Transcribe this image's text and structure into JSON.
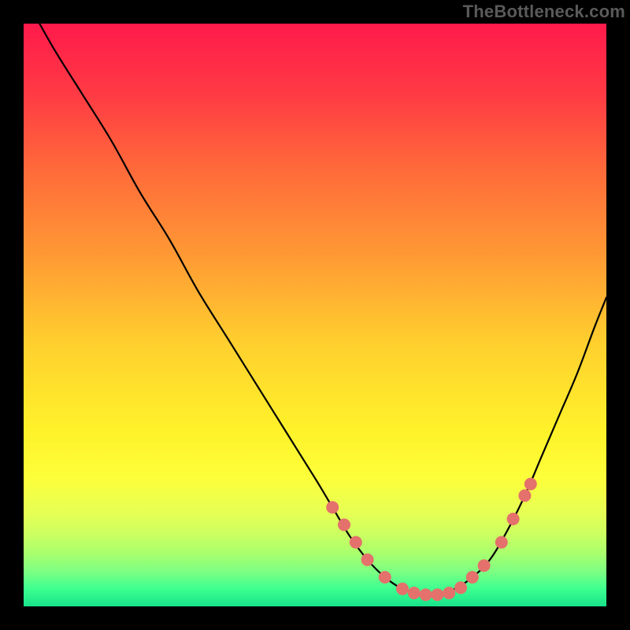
{
  "watermark": {
    "text": "TheBottleneck.com"
  },
  "gradient": {
    "stops": [
      {
        "pct": 0,
        "color": "#ff1a4b"
      },
      {
        "pct": 12,
        "color": "#ff3a44"
      },
      {
        "pct": 25,
        "color": "#ff6a3a"
      },
      {
        "pct": 40,
        "color": "#ff9a34"
      },
      {
        "pct": 55,
        "color": "#ffd02e"
      },
      {
        "pct": 70,
        "color": "#fff22a"
      },
      {
        "pct": 78,
        "color": "#fcff3a"
      },
      {
        "pct": 84,
        "color": "#e6ff55"
      },
      {
        "pct": 88,
        "color": "#c8ff62"
      },
      {
        "pct": 91,
        "color": "#a8ff6e"
      },
      {
        "pct": 94,
        "color": "#7dff82"
      },
      {
        "pct": 97,
        "color": "#3dff90"
      },
      {
        "pct": 100,
        "color": "#18e38a"
      }
    ]
  },
  "curve_color": "#000000",
  "marker_color": "#e4716b",
  "marker_radius": 8,
  "chart_data": {
    "type": "line",
    "title": "",
    "xlabel": "",
    "ylabel": "",
    "xlim": [
      0,
      100
    ],
    "ylim": [
      0,
      100
    ],
    "series": [
      {
        "name": "curve",
        "x": [
          0,
          5,
          10,
          15,
          20,
          25,
          30,
          35,
          40,
          45,
          50,
          53,
          56,
          59,
          62,
          65,
          68,
          71,
          74,
          77,
          80,
          83,
          86,
          89,
          92,
          95,
          98,
          100
        ],
        "values": [
          105,
          96,
          88,
          80,
          71,
          63,
          54,
          46,
          38,
          30,
          22,
          17,
          12,
          8,
          5,
          3,
          2,
          2,
          3,
          5,
          8,
          13,
          19,
          26,
          33,
          40,
          48,
          53
        ]
      }
    ],
    "markers": {
      "name": "highlight-points",
      "x": [
        53,
        55,
        57,
        59,
        62,
        65,
        67,
        69,
        71,
        73,
        75,
        77,
        79,
        82,
        84,
        86,
        87
      ],
      "values": [
        17,
        14,
        11,
        8,
        5,
        3,
        2.3,
        2,
        2,
        2.3,
        3.2,
        5,
        7,
        11,
        15,
        19,
        21
      ]
    }
  }
}
